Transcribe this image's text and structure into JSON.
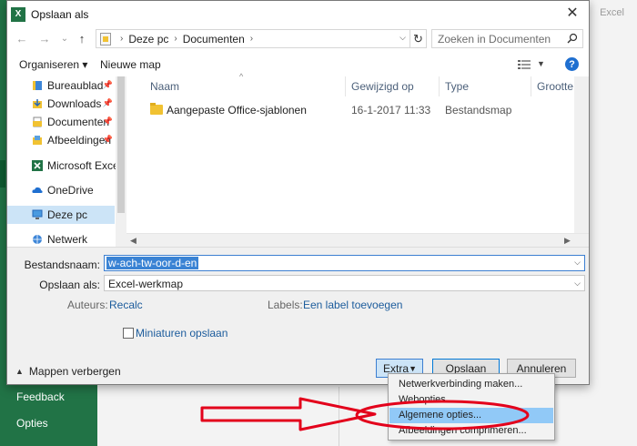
{
  "background": {
    "excel_label": "Excel",
    "left_items": [
      "Feedback",
      "Opties"
    ]
  },
  "dialog": {
    "title": "Opslaan als",
    "app_icon_letter": "X",
    "close_glyph": "✕"
  },
  "nav": {
    "back_glyph": "←",
    "forward_glyph": "→",
    "recent_glyph": "⌄",
    "up_glyph": "↑",
    "breadcrumbs": [
      "Deze pc",
      "Documenten"
    ],
    "search_placeholder": "Zoeken in Documenten"
  },
  "toolbar": {
    "organize_label": "Organiseren ▾",
    "new_folder_label": "Nieuwe map",
    "help_glyph": "?"
  },
  "sidebar": {
    "items": [
      {
        "label": "Bureaublad",
        "icon": "desktop-icon",
        "pinned": true
      },
      {
        "label": "Downloads",
        "icon": "download-icon",
        "pinned": true
      },
      {
        "label": "Documenten",
        "icon": "documents-icon",
        "pinned": true
      },
      {
        "label": "Afbeeldingen",
        "icon": "pictures-icon",
        "pinned": true
      },
      {
        "label": "Microsoft Excel",
        "icon": "excel-icon",
        "pinned": false
      },
      {
        "label": "OneDrive",
        "icon": "cloud-icon",
        "pinned": false
      },
      {
        "label": "Deze pc",
        "icon": "computer-icon",
        "pinned": false
      },
      {
        "label": "Netwerk",
        "icon": "network-icon",
        "pinned": false
      }
    ],
    "selected": "Deze pc"
  },
  "files": {
    "columns": [
      "Naam",
      "Gewijzigd op",
      "Type",
      "Grootte"
    ],
    "rows": [
      {
        "name": "Aangepaste Office-sjablonen",
        "modified": "16-1-2017 11:33",
        "type": "Bestandsmap",
        "size": ""
      }
    ]
  },
  "form": {
    "filename_label": "Bestandsnaam:",
    "filename_value": "w-ach-tw-oor-d-en",
    "filetype_label": "Opslaan als:",
    "filetype_value": "Excel-werkmap",
    "authors_label": "Auteurs:",
    "authors_value": "Recalc",
    "labels_label": "Labels:",
    "labels_value": "Een label toevoegen",
    "thumbnails_label": "Miniaturen opslaan",
    "hide_folders_label": "Mappen verbergen"
  },
  "buttons": {
    "extra": "Extra",
    "save": "Opslaan",
    "cancel": "Annuleren"
  },
  "extra_menu": {
    "items": [
      "Netwerkverbinding maken...",
      "Webopties...",
      "Algemene opties...",
      "Afbeeldingen comprimeren..."
    ],
    "highlighted": "Algemene opties..."
  },
  "colors": {
    "excel_green": "#217346",
    "selection_blue": "#cce4f7",
    "annotation_red": "#e3001b"
  }
}
